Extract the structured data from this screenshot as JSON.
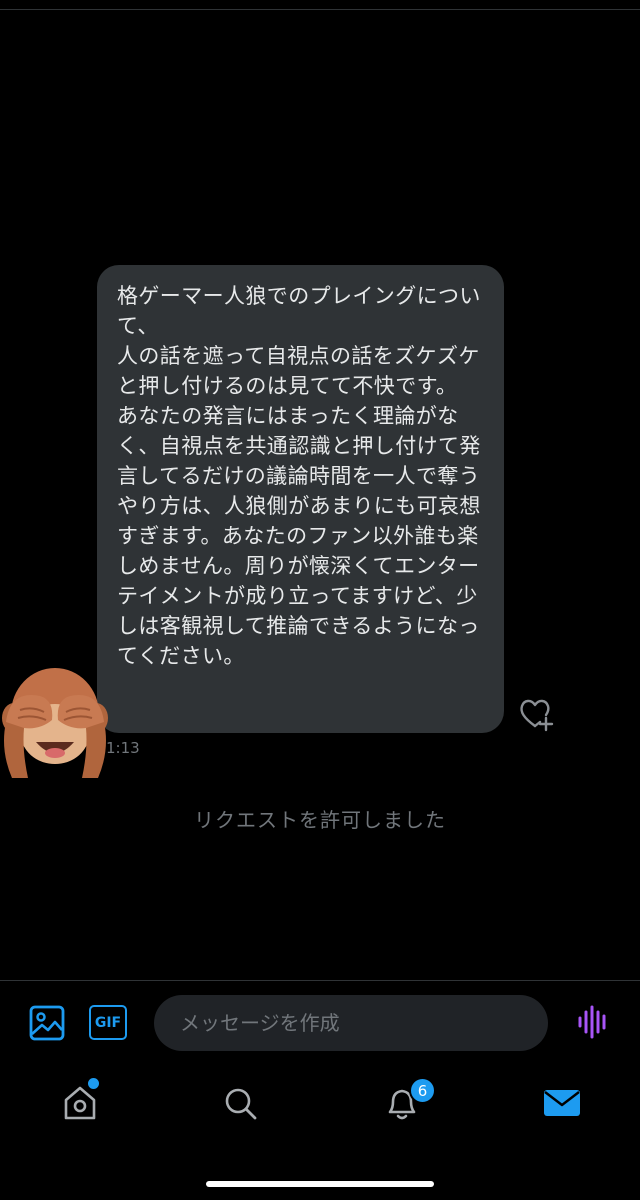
{
  "message": {
    "text": "格ゲーマー人狼でのプレイングについて、\n人の話を遮って自視点の話をズケズケと押し付けるのは見てて不快です。\nあなたの発言にはまったく理論がなく、自視点を共通認識と押し付けて発言してるだけの議論時間を一人で奪うやり方は、人狼側があまりにも可哀想すぎます。あなたのファン以外誰も楽しめません。周りが懐深くてエンターテイメントが成り立ってますけど、少しは客観視して推論できるようになってください。",
    "timestamp": "1:13",
    "avatar_icon": "see-no-evil-monkey-icon",
    "like_icon": "heart-plus-icon"
  },
  "system_message": "リクエストを許可しました",
  "composer": {
    "placeholder": "メッセージを作成",
    "value": "",
    "gif_label": "GIF",
    "media_icon": "image-icon",
    "voice_icon": "voice-waveform-icon"
  },
  "tabbar": {
    "items": [
      {
        "name": "home",
        "icon": "home-icon",
        "has_dot": true
      },
      {
        "name": "search",
        "icon": "search-icon"
      },
      {
        "name": "notifications",
        "icon": "bell-icon",
        "badge": "6"
      },
      {
        "name": "messages",
        "icon": "envelope-icon",
        "active": true
      }
    ]
  },
  "colors": {
    "background": "#000000",
    "bubble": "#2f3336",
    "accent": "#1d9bf0",
    "muted": "#71767b",
    "voice": "#a855f7"
  }
}
